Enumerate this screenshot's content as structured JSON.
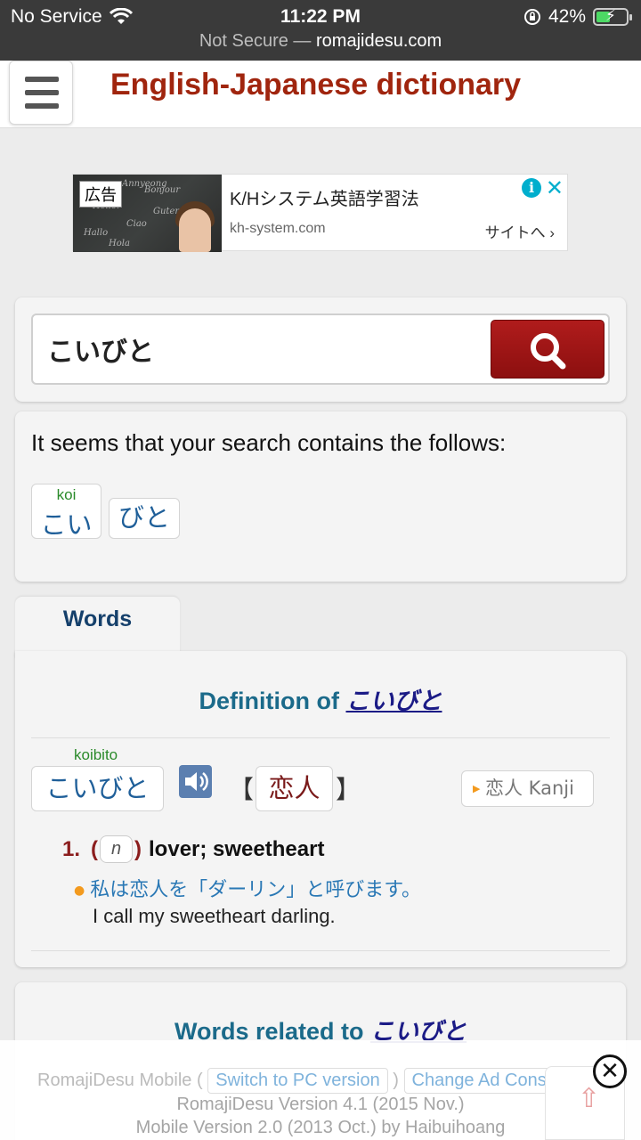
{
  "status_bar": {
    "carrier": "No Service",
    "time": "11:22 PM",
    "battery": "42%",
    "battery_level": 0.42,
    "url_prefix": "Not Secure —",
    "url_domain": "romajidesu.com"
  },
  "header": {
    "title": "English-Japanese dictionary",
    "menu_icon": "hamburger-menu-icon"
  },
  "ad": {
    "badge": "広告",
    "title": "K/Hシステム英語学習法",
    "domain": "kh-system.com",
    "cta": "サイトへ ›",
    "info_icon": "i",
    "close_icon": "✕",
    "image_chalk": [
      "Hello!",
      "Bonjour",
      "Ciao",
      "Hallo",
      "Guten",
      "Hola",
      "Annyeong"
    ]
  },
  "search": {
    "value": "こいびと",
    "button_icon": "search-icon"
  },
  "follows": {
    "text": "It seems that your search contains the follows:",
    "parts": [
      {
        "kana": "こい",
        "ruby": "koi"
      },
      {
        "kana": "びと",
        "ruby": ""
      }
    ]
  },
  "tabs": {
    "words": "Words"
  },
  "definition": {
    "prefix": "Definition of ",
    "term": "こいびと",
    "reading_ruby": "koibito",
    "reading": "こいびと",
    "bracket_open": "【",
    "kanji": "恋人",
    "bracket_close": "】",
    "kanji_link": "恋人 Kanji",
    "senses": [
      {
        "number": "1.",
        "pos": "n",
        "gloss": "lover; sweetheart",
        "example_jp": "私は恋人を「ダーリン」と呼びます。",
        "example_en": "I call my sweetheart darling."
      }
    ]
  },
  "related": {
    "prefix": "Words related to ",
    "term": "こいびと"
  },
  "footer": {
    "brand": "RomajiDesu Mobile (",
    "switch_pc": "Switch to PC version",
    "sep": ")",
    "change_ad": "Change Ad Consent",
    "version_line": "RomajiDesu Version 4.1 (2015 Nov.)",
    "mobile_line": "Mobile Version 2.0 (2013 Oct.) by Haibuihoang",
    "close_icon": "✕",
    "to_top_icon": "⇧"
  },
  "colors": {
    "title_red": "#a0250e",
    "search_button": "#8c0f0f",
    "link_blue": "#1f5f99",
    "heading_teal": "#1b6a8a",
    "ruby_green": "#2a8a2a"
  }
}
